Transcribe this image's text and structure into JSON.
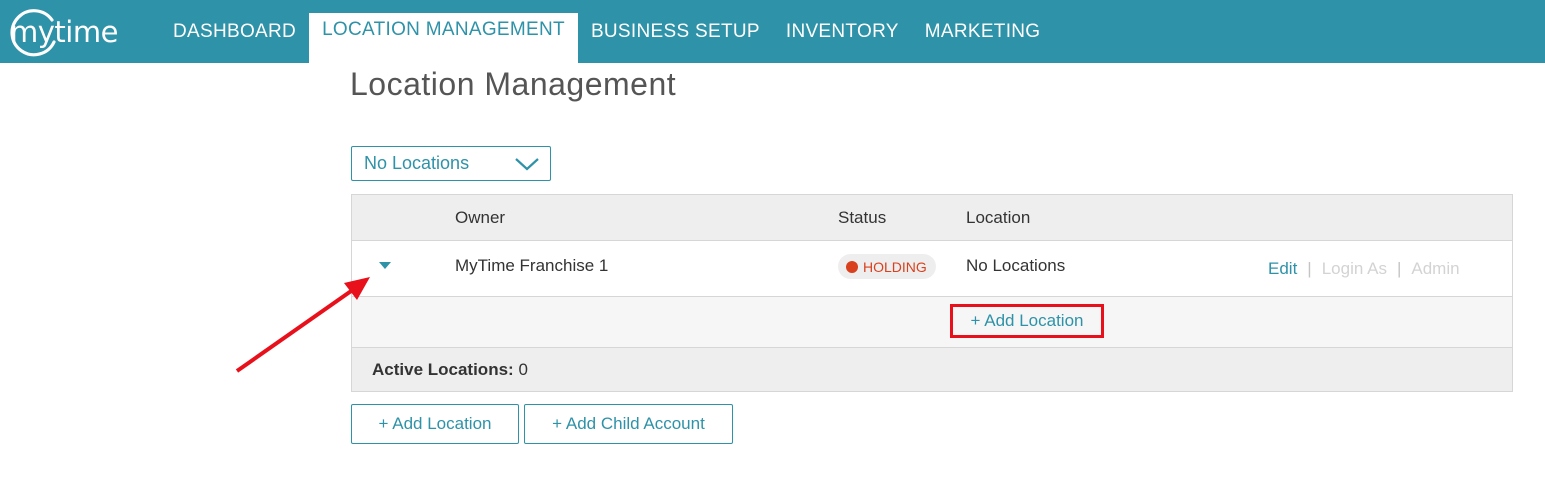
{
  "app": {
    "logo_text": "mytime"
  },
  "nav": {
    "items": [
      {
        "label": "DASHBOARD"
      },
      {
        "label": "LOCATION MANAGEMENT",
        "active": true
      },
      {
        "label": "BUSINESS SETUP"
      },
      {
        "label": "INVENTORY"
      },
      {
        "label": "MARKETING"
      }
    ]
  },
  "page": {
    "title": "Location Management"
  },
  "location_select": {
    "value": "No Locations"
  },
  "table": {
    "headers": {
      "owner": "Owner",
      "status": "Status",
      "location": "Location"
    },
    "rows": [
      {
        "owner": "MyTime Franchise 1",
        "status": "HOLDING",
        "location": "No Locations",
        "actions": {
          "edit": "Edit",
          "login_as": "Login As",
          "admin": "Admin"
        },
        "separator": "|"
      }
    ],
    "sub_action": "+ Add Location",
    "footer": {
      "label": "Active Locations:",
      "value": "0"
    }
  },
  "buttons": {
    "add_location": "+ Add Location",
    "add_child_account": "+ Add Child Account"
  },
  "colors": {
    "brand": "#2e92a8",
    "status_holding": "#d9411e",
    "annotation": "#e8101b"
  }
}
